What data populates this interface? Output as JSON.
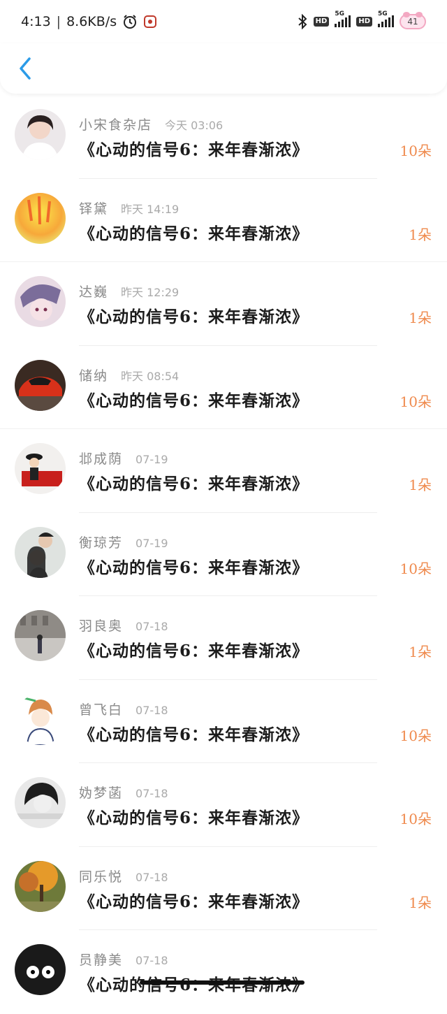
{
  "status_bar": {
    "time": "4:13",
    "speed": "8.6KB/s",
    "net1": "5G",
    "net2": "5G",
    "hd": "HD",
    "battery": "41"
  },
  "items": [
    {
      "name": "小宋食杂店",
      "time": "今天 03:06",
      "title": "《心动的信号6：来年春渐浓》",
      "flowers": "10朵"
    },
    {
      "name": "铎黛",
      "time": "昨天 14:19",
      "title": "《心动的信号6：来年春渐浓》",
      "flowers": "1朵"
    },
    {
      "name": "达巍",
      "time": "昨天 12:29",
      "title": "《心动的信号6：来年春渐浓》",
      "flowers": "1朵"
    },
    {
      "name": "储纳",
      "time": "昨天 08:54",
      "title": "《心动的信号6：来年春渐浓》",
      "flowers": "10朵"
    },
    {
      "name": "邶成荫",
      "time": "07-19",
      "title": "《心动的信号6：来年春渐浓》",
      "flowers": "1朵"
    },
    {
      "name": "衡琼芳",
      "time": "07-19",
      "title": "《心动的信号6：来年春渐浓》",
      "flowers": "10朵"
    },
    {
      "name": "羽良奥",
      "time": "07-18",
      "title": "《心动的信号6：来年春渐浓》",
      "flowers": "1朵"
    },
    {
      "name": "曾飞白",
      "time": "07-18",
      "title": "《心动的信号6：来年春渐浓》",
      "flowers": "10朵"
    },
    {
      "name": "妫梦菡",
      "time": "07-18",
      "title": "《心动的信号6：来年春渐浓》",
      "flowers": "10朵"
    },
    {
      "name": "同乐悦",
      "time": "07-18",
      "title": "《心动的信号6：来年春渐浓》",
      "flowers": "1朵"
    },
    {
      "name": "员静美",
      "time": "07-18",
      "title": "《心动的信号6：来年春渐浓》",
      "flowers": ""
    }
  ],
  "colors": {
    "accent_back": "#2b9be8",
    "flower_count": "#ef8a4d"
  }
}
